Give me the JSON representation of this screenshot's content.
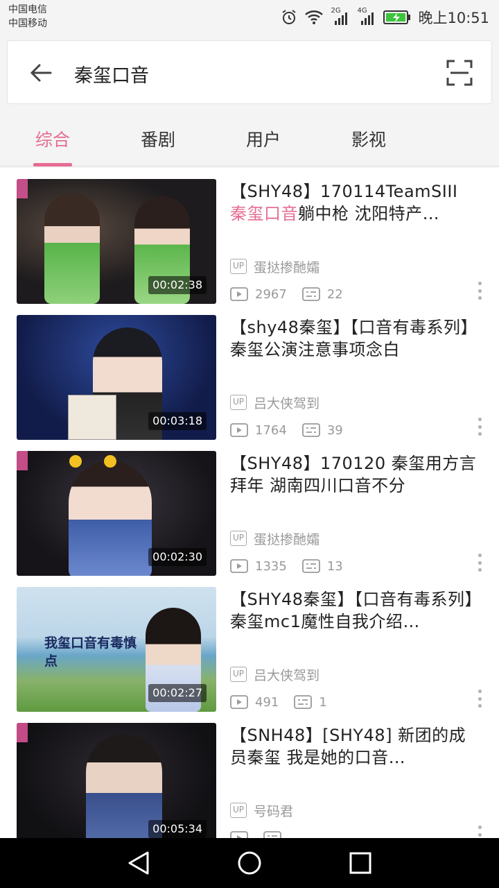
{
  "status_bar": {
    "carrier1": "中国电信",
    "carrier2": "中国移动",
    "signal1_label": "2G",
    "signal2_label": "4G",
    "time": "晚上10:51",
    "icons": [
      "alarm-icon",
      "wifi-icon",
      "signal-icon",
      "battery-charging-icon"
    ]
  },
  "search": {
    "query": "秦玺口音",
    "back_icon": "arrow-left-icon",
    "scan_icon": "scan-icon"
  },
  "tabs": [
    {
      "label": "综合",
      "active": true
    },
    {
      "label": "番剧",
      "active": false
    },
    {
      "label": "用户",
      "active": false
    },
    {
      "label": "影视",
      "active": false
    }
  ],
  "colors": {
    "accent": "#e56d91"
  },
  "results": [
    {
      "title_prefix": "【SHY48】170114TeamSIII ",
      "title_highlight": "秦玺口音",
      "title_suffix": "躺中枪  沈阳特产…",
      "duration": "00:02:38",
      "uploader": "蛋挞掺酏孀",
      "views": "2967",
      "comments": "22"
    },
    {
      "title_prefix": "【shy48秦玺】【口音有毒系列】秦玺公演注意事项念白",
      "title_highlight": "",
      "title_suffix": "",
      "duration": "00:03:18",
      "uploader": "吕大侠驾到",
      "views": "1764",
      "comments": "39"
    },
    {
      "title_prefix": "【SHY48】170120  秦玺用方言拜年  湖南四川口音不分",
      "title_highlight": "",
      "title_suffix": "",
      "duration": "00:02:30",
      "uploader": "蛋挞掺酏孀",
      "views": "1335",
      "comments": "13"
    },
    {
      "title_prefix": "【SHY48秦玺】【口音有毒系列】秦玺mc1魔性自我介绍…",
      "title_highlight": "",
      "title_suffix": "",
      "duration": "00:02:27",
      "uploader": "吕大侠驾到",
      "views": "491",
      "comments": "1",
      "thumb_caption": "我玺口音有毒慎点"
    },
    {
      "title_prefix": "【SNH48】[SHY48] 新团的成员秦玺  我是她的口音…",
      "title_highlight": "",
      "title_suffix": "",
      "duration": "00:05:34",
      "uploader": "号码君",
      "views": "",
      "comments": ""
    }
  ],
  "badges": {
    "up": "UP"
  },
  "nav": [
    "back-icon",
    "home-icon",
    "recents-icon"
  ]
}
